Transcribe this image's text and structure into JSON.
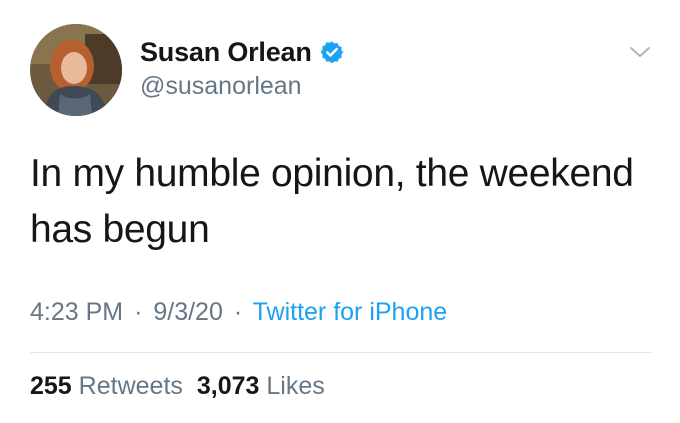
{
  "user": {
    "display_name": "Susan Orlean",
    "handle": "@susanorlean",
    "verified": true,
    "avatar_icon": "profile-photo"
  },
  "tweet": {
    "text_line1": "In my humble opinion, the weekend",
    "text_line2": "has begun",
    "time": "4:23 PM",
    "date": "9/3/20",
    "separator": "·",
    "source": "Twitter for iPhone"
  },
  "stats": {
    "retweets_count": "255",
    "retweets_label": "Retweets",
    "likes_count": "3,073",
    "likes_label": "Likes"
  },
  "colors": {
    "verified_badge": "#1da1f2",
    "source_link": "#1da1f2",
    "secondary_text": "#657786"
  }
}
